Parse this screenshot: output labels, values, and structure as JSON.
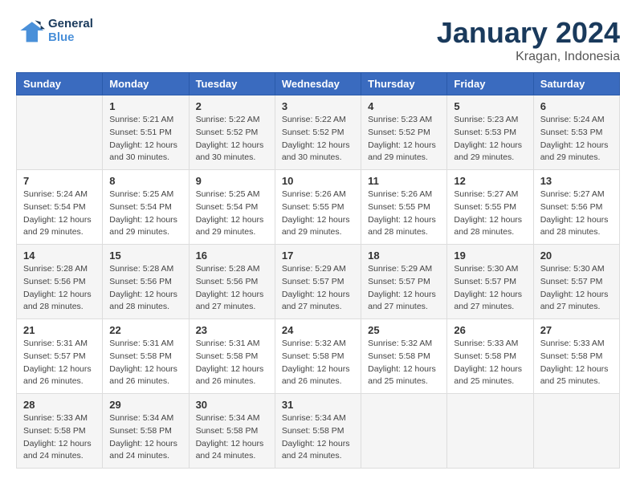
{
  "logo": {
    "line1": "General",
    "line2": "Blue"
  },
  "title": "January 2024",
  "subtitle": "Kragan, Indonesia",
  "days_of_week": [
    "Sunday",
    "Monday",
    "Tuesday",
    "Wednesday",
    "Thursday",
    "Friday",
    "Saturday"
  ],
  "weeks": [
    [
      {
        "day": "",
        "info": ""
      },
      {
        "day": "1",
        "info": "Sunrise: 5:21 AM\nSunset: 5:51 PM\nDaylight: 12 hours\nand 30 minutes."
      },
      {
        "day": "2",
        "info": "Sunrise: 5:22 AM\nSunset: 5:52 PM\nDaylight: 12 hours\nand 30 minutes."
      },
      {
        "day": "3",
        "info": "Sunrise: 5:22 AM\nSunset: 5:52 PM\nDaylight: 12 hours\nand 30 minutes."
      },
      {
        "day": "4",
        "info": "Sunrise: 5:23 AM\nSunset: 5:52 PM\nDaylight: 12 hours\nand 29 minutes."
      },
      {
        "day": "5",
        "info": "Sunrise: 5:23 AM\nSunset: 5:53 PM\nDaylight: 12 hours\nand 29 minutes."
      },
      {
        "day": "6",
        "info": "Sunrise: 5:24 AM\nSunset: 5:53 PM\nDaylight: 12 hours\nand 29 minutes."
      }
    ],
    [
      {
        "day": "7",
        "info": "Sunrise: 5:24 AM\nSunset: 5:54 PM\nDaylight: 12 hours\nand 29 minutes."
      },
      {
        "day": "8",
        "info": "Sunrise: 5:25 AM\nSunset: 5:54 PM\nDaylight: 12 hours\nand 29 minutes."
      },
      {
        "day": "9",
        "info": "Sunrise: 5:25 AM\nSunset: 5:54 PM\nDaylight: 12 hours\nand 29 minutes."
      },
      {
        "day": "10",
        "info": "Sunrise: 5:26 AM\nSunset: 5:55 PM\nDaylight: 12 hours\nand 29 minutes."
      },
      {
        "day": "11",
        "info": "Sunrise: 5:26 AM\nSunset: 5:55 PM\nDaylight: 12 hours\nand 28 minutes."
      },
      {
        "day": "12",
        "info": "Sunrise: 5:27 AM\nSunset: 5:55 PM\nDaylight: 12 hours\nand 28 minutes."
      },
      {
        "day": "13",
        "info": "Sunrise: 5:27 AM\nSunset: 5:56 PM\nDaylight: 12 hours\nand 28 minutes."
      }
    ],
    [
      {
        "day": "14",
        "info": "Sunrise: 5:28 AM\nSunset: 5:56 PM\nDaylight: 12 hours\nand 28 minutes."
      },
      {
        "day": "15",
        "info": "Sunrise: 5:28 AM\nSunset: 5:56 PM\nDaylight: 12 hours\nand 28 minutes."
      },
      {
        "day": "16",
        "info": "Sunrise: 5:28 AM\nSunset: 5:56 PM\nDaylight: 12 hours\nand 27 minutes."
      },
      {
        "day": "17",
        "info": "Sunrise: 5:29 AM\nSunset: 5:57 PM\nDaylight: 12 hours\nand 27 minutes."
      },
      {
        "day": "18",
        "info": "Sunrise: 5:29 AM\nSunset: 5:57 PM\nDaylight: 12 hours\nand 27 minutes."
      },
      {
        "day": "19",
        "info": "Sunrise: 5:30 AM\nSunset: 5:57 PM\nDaylight: 12 hours\nand 27 minutes."
      },
      {
        "day": "20",
        "info": "Sunrise: 5:30 AM\nSunset: 5:57 PM\nDaylight: 12 hours\nand 27 minutes."
      }
    ],
    [
      {
        "day": "21",
        "info": "Sunrise: 5:31 AM\nSunset: 5:57 PM\nDaylight: 12 hours\nand 26 minutes."
      },
      {
        "day": "22",
        "info": "Sunrise: 5:31 AM\nSunset: 5:58 PM\nDaylight: 12 hours\nand 26 minutes."
      },
      {
        "day": "23",
        "info": "Sunrise: 5:31 AM\nSunset: 5:58 PM\nDaylight: 12 hours\nand 26 minutes."
      },
      {
        "day": "24",
        "info": "Sunrise: 5:32 AM\nSunset: 5:58 PM\nDaylight: 12 hours\nand 26 minutes."
      },
      {
        "day": "25",
        "info": "Sunrise: 5:32 AM\nSunset: 5:58 PM\nDaylight: 12 hours\nand 25 minutes."
      },
      {
        "day": "26",
        "info": "Sunrise: 5:33 AM\nSunset: 5:58 PM\nDaylight: 12 hours\nand 25 minutes."
      },
      {
        "day": "27",
        "info": "Sunrise: 5:33 AM\nSunset: 5:58 PM\nDaylight: 12 hours\nand 25 minutes."
      }
    ],
    [
      {
        "day": "28",
        "info": "Sunrise: 5:33 AM\nSunset: 5:58 PM\nDaylight: 12 hours\nand 24 minutes."
      },
      {
        "day": "29",
        "info": "Sunrise: 5:34 AM\nSunset: 5:58 PM\nDaylight: 12 hours\nand 24 minutes."
      },
      {
        "day": "30",
        "info": "Sunrise: 5:34 AM\nSunset: 5:58 PM\nDaylight: 12 hours\nand 24 minutes."
      },
      {
        "day": "31",
        "info": "Sunrise: 5:34 AM\nSunset: 5:58 PM\nDaylight: 12 hours\nand 24 minutes."
      },
      {
        "day": "",
        "info": ""
      },
      {
        "day": "",
        "info": ""
      },
      {
        "day": "",
        "info": ""
      }
    ]
  ]
}
